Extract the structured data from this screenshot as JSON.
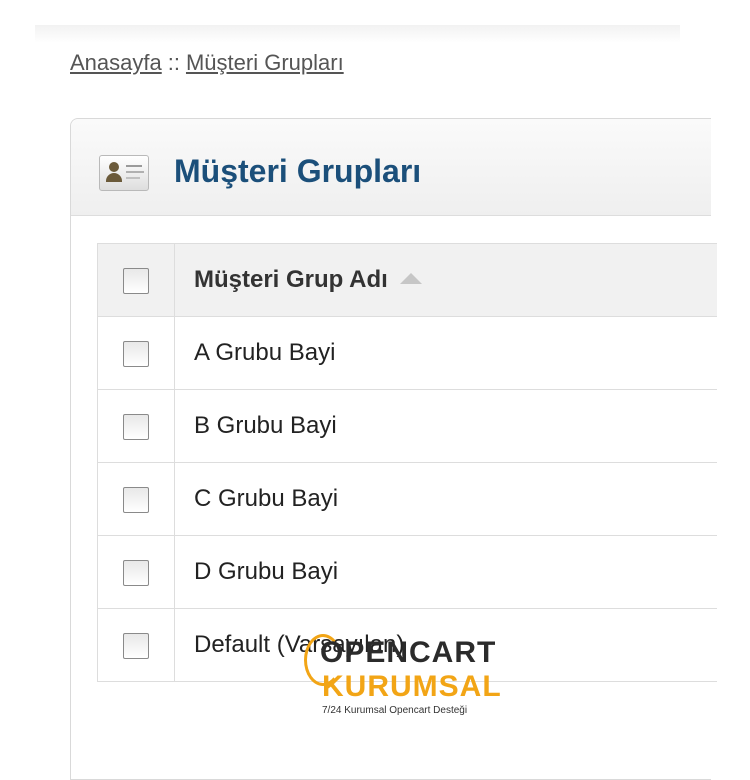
{
  "breadcrumb": {
    "home": "Anasayfa",
    "separator": "::",
    "current": "Müşteri Grupları"
  },
  "heading": {
    "icon": "customer-card-icon",
    "title": "Müşteri Grupları"
  },
  "table": {
    "column_header": "Müşteri Grup Adı",
    "sort": "ascending",
    "rows": [
      "A Grubu Bayi",
      "B Grubu Bayi",
      "C Grubu Bayi",
      "D Grubu Bayi",
      "Default (Varsayılan)"
    ]
  },
  "watermark": {
    "line1": "OPENCART",
    "line2": "KURUMSAL",
    "line3": "7/24 Kurumsal Opencart Desteği"
  },
  "colors": {
    "title": "#1b4f7a",
    "watermark_accent": "#f2a516"
  }
}
